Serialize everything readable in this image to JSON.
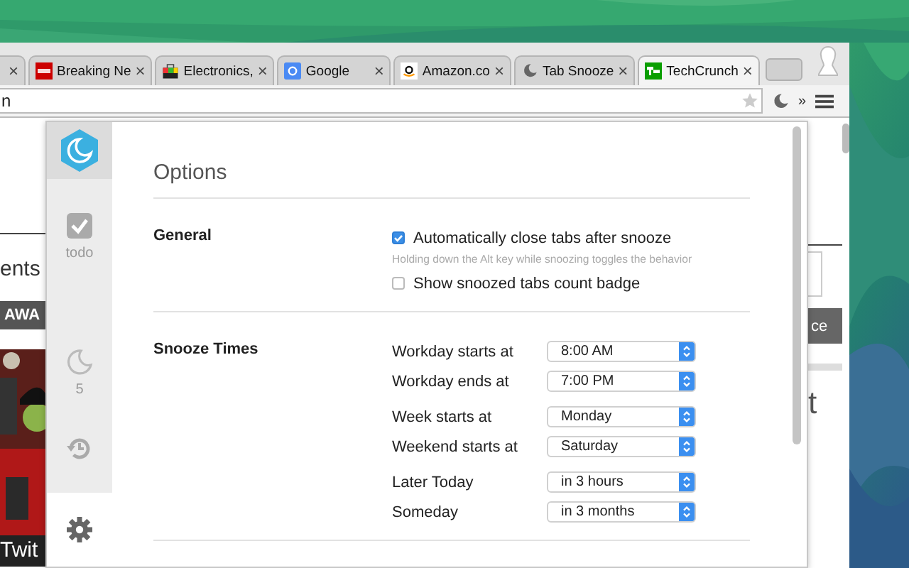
{
  "browser": {
    "tabs": [
      {
        "close": "×",
        "selected": false
      },
      {
        "title": "Breaking Ne",
        "kind": "news",
        "close": "×",
        "selected": false
      },
      {
        "title": "Electronics,",
        "kind": "shop",
        "close": "×",
        "selected": false
      },
      {
        "title": "Google",
        "kind": "search",
        "close": "×",
        "selected": false
      },
      {
        "title": "Amazon.co",
        "kind": "store",
        "close": "×",
        "selected": false
      },
      {
        "title": "Tab Snooze",
        "kind": "snooze",
        "close": "×",
        "selected": false
      },
      {
        "title": "TechCrunch",
        "kind": "tech",
        "close": "×",
        "selected": true
      }
    ],
    "address": {
      "value": "n"
    },
    "overflow": "»"
  },
  "background_page": {
    "left": {
      "heading": "ents",
      "banner": "AWA",
      "caption": "Twit"
    },
    "right": {
      "button": "ce",
      "heading": "t"
    }
  },
  "popup": {
    "sidebar": {
      "items": [
        {
          "kind": "todo",
          "label": "todo",
          "selected": false
        },
        {
          "kind": "snoozed",
          "label": "5",
          "selected": false
        },
        {
          "kind": "history",
          "selected": false
        },
        {
          "kind": "settings",
          "selected": true
        }
      ]
    },
    "options": {
      "title": "Options",
      "sections": [
        {
          "title": "General",
          "items": [
            {
              "kind": "checkbox",
              "label": "Automatically close tabs after snooze",
              "checked": true
            },
            {
              "kind": "hint",
              "text": "Holding down the Alt key while snoozing toggles the behavior"
            },
            {
              "kind": "checkbox",
              "label": "Show snoozed tabs count badge",
              "checked": false
            }
          ]
        },
        {
          "title": "Snooze Times",
          "groups": [
            [
              {
                "label": "Workday starts at",
                "value": "8:00 AM"
              },
              {
                "label": "Workday ends at",
                "value": "7:00 PM"
              }
            ],
            [
              {
                "label": "Week starts at",
                "value": "Monday"
              },
              {
                "label": "Weekend starts at",
                "value": "Saturday"
              }
            ],
            [
              {
                "label": "Later Today",
                "value": "in 3 hours"
              },
              {
                "label": "Someday",
                "value": "in 3 months"
              }
            ]
          ]
        }
      ]
    }
  }
}
